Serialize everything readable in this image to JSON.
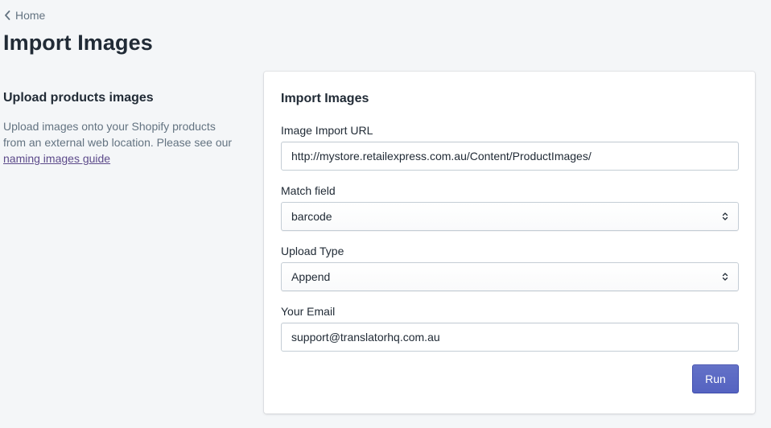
{
  "breadcrumb": {
    "label": "Home",
    "icon": "chevron-left-icon"
  },
  "page": {
    "title": "Import Images"
  },
  "annotation": {
    "heading": "Upload products images",
    "description": "Upload images onto your Shopify products from an external web location. Please see our",
    "link_label": "naming images guide"
  },
  "card": {
    "title": "Import Images",
    "fields": {
      "image_url": {
        "label": "Image Import URL",
        "value": "http://mystore.retailexpress.com.au/Content/ProductImages/"
      },
      "match_field": {
        "label": "Match field",
        "value": "barcode"
      },
      "upload_type": {
        "label": "Upload Type",
        "value": "Append"
      },
      "email": {
        "label": "Your Email",
        "value": "support@translatorhq.com.au"
      }
    },
    "run_label": "Run"
  },
  "colors": {
    "background": "#f4f6f8",
    "primary": "#5c6ac4",
    "link": "#5c4a8a",
    "subdued_text": "#637381"
  }
}
